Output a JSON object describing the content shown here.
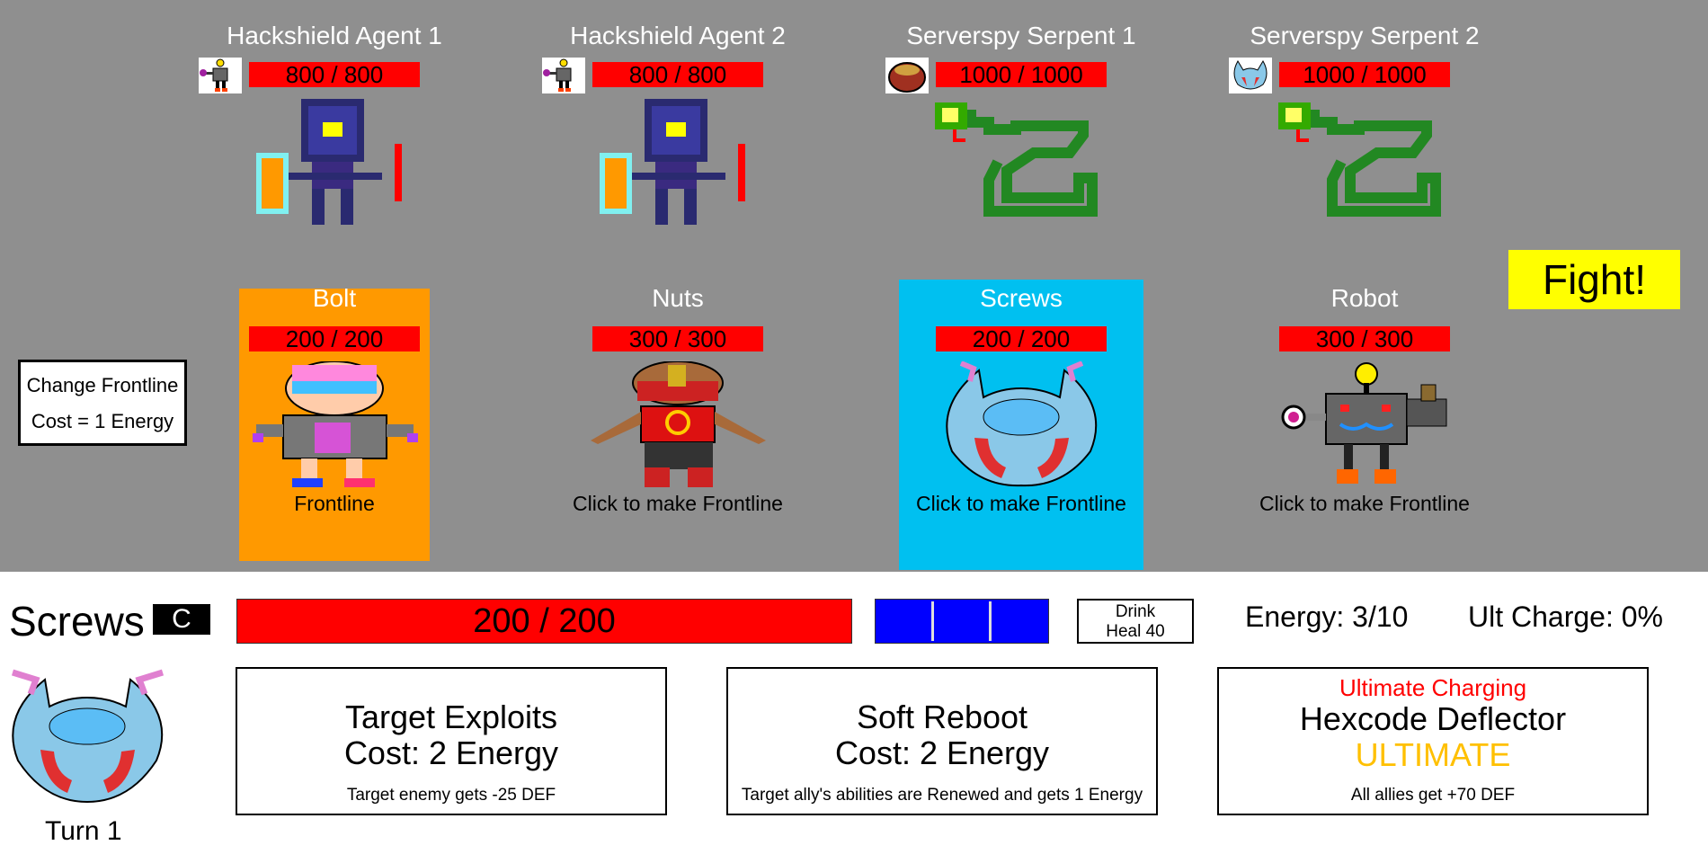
{
  "enemies": [
    {
      "name": "Hackshield Agent 1",
      "hp": "800 / 800"
    },
    {
      "name": "Hackshield Agent 2",
      "hp": "800 / 800"
    },
    {
      "name": "Serverspy Serpent 1",
      "hp": "1000 / 1000"
    },
    {
      "name": "Serverspy Serpent 2",
      "hp": "1000 / 1000"
    }
  ],
  "allies": [
    {
      "name": "Bolt",
      "hp": "200 / 200",
      "status": "Frontline",
      "card_color": "#ff9900"
    },
    {
      "name": "Nuts",
      "hp": "300 / 300",
      "status": "Click to make Frontline"
    },
    {
      "name": "Screws",
      "hp": "200 / 200",
      "status": "Click to make Frontline",
      "card_color": "#00c0f0"
    },
    {
      "name": "Robot",
      "hp": "300 / 300",
      "status": "Click to make Frontline"
    }
  ],
  "change_frontline": {
    "line1": "Change Frontline",
    "line2": "Cost = 1 Energy"
  },
  "fight_button": "Fight!",
  "selected": {
    "name": "Screws",
    "hotkey": "C",
    "hp": "200 / 200",
    "energy_segments": 3,
    "drink": {
      "line1": "Drink",
      "line2": "Heal 40"
    },
    "energy": "Energy: 3/10",
    "ult_charge": "Ult Charge: 0%",
    "turn": "Turn 1"
  },
  "abilities": [
    {
      "title": "Target Exploits",
      "cost": "Cost: 2 Energy",
      "desc": "Target enemy gets -25 DEF"
    },
    {
      "title": "Soft Reboot",
      "cost": "Cost: 2 Energy",
      "desc": "Target ally's abilities are Renewed and gets 1 Energy"
    },
    {
      "status": "Ultimate Charging",
      "title": "Hexcode Deflector",
      "tag": "ULTIMATE",
      "desc": "All allies get +70 DEF"
    }
  ],
  "colors": {
    "hp": "#ff0000",
    "energy": "#0000ff",
    "fight": "#ffff00",
    "ultimate": "#ffc000",
    "charging": "#ff0000"
  }
}
